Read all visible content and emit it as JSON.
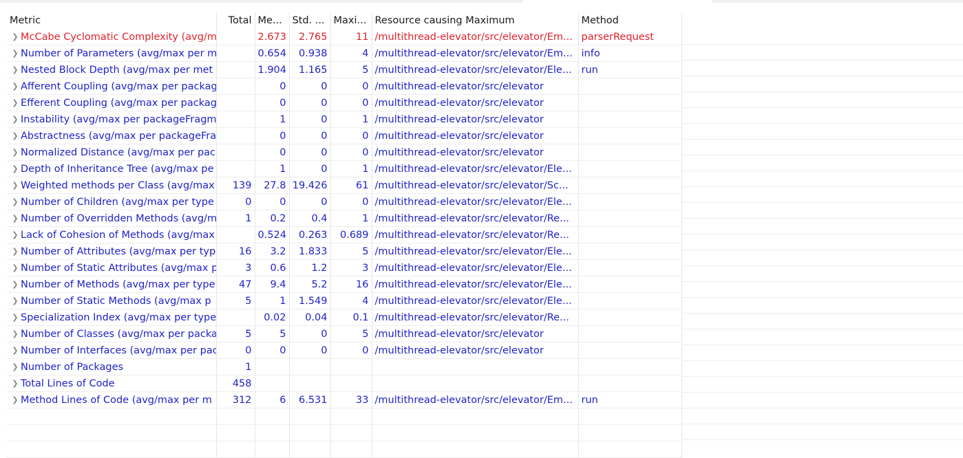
{
  "columns": {
    "metric": "Metric",
    "total": "Total",
    "mean": "Me...",
    "std": "Std. ...",
    "max": "Maxi...",
    "resource": "Resource causing Maximum",
    "method": "Method"
  },
  "rows": [
    {
      "metric": "McCabe Cyclomatic Complexity (avg/m",
      "total": "",
      "mean": "2.673",
      "std": "2.765",
      "max": "11",
      "resource": "/multithread-elevator/src/elevator/Em...",
      "method": "parserRequest"
    },
    {
      "metric": "Number of Parameters (avg/max per m",
      "total": "",
      "mean": "0.654",
      "std": "0.938",
      "max": "4",
      "resource": "/multithread-elevator/src/elevator/Em...",
      "method": "info"
    },
    {
      "metric": "Nested Block Depth (avg/max per met",
      "total": "",
      "mean": "1.904",
      "std": "1.165",
      "max": "5",
      "resource": "/multithread-elevator/src/elevator/Ele...",
      "method": "run"
    },
    {
      "metric": "Afferent Coupling (avg/max per packag",
      "total": "",
      "mean": "0",
      "std": "0",
      "max": "0",
      "resource": "/multithread-elevator/src/elevator",
      "method": ""
    },
    {
      "metric": "Efferent Coupling (avg/max per packag",
      "total": "",
      "mean": "0",
      "std": "0",
      "max": "0",
      "resource": "/multithread-elevator/src/elevator",
      "method": ""
    },
    {
      "metric": "Instability (avg/max per packageFragm",
      "total": "",
      "mean": "1",
      "std": "0",
      "max": "1",
      "resource": "/multithread-elevator/src/elevator",
      "method": ""
    },
    {
      "metric": "Abstractness (avg/max per packageFra",
      "total": "",
      "mean": "0",
      "std": "0",
      "max": "0",
      "resource": "/multithread-elevator/src/elevator",
      "method": ""
    },
    {
      "metric": "Normalized Distance (avg/max per pac",
      "total": "",
      "mean": "0",
      "std": "0",
      "max": "0",
      "resource": "/multithread-elevator/src/elevator",
      "method": ""
    },
    {
      "metric": "Depth of Inheritance Tree (avg/max pe",
      "total": "",
      "mean": "1",
      "std": "0",
      "max": "1",
      "resource": "/multithread-elevator/src/elevator/Ele...",
      "method": ""
    },
    {
      "metric": "Weighted methods per Class (avg/max",
      "total": "139",
      "mean": "27.8",
      "std": "19.426",
      "max": "61",
      "resource": "/multithread-elevator/src/elevator/Sc...",
      "method": ""
    },
    {
      "metric": "Number of Children (avg/max per type",
      "total": "0",
      "mean": "0",
      "std": "0",
      "max": "0",
      "resource": "/multithread-elevator/src/elevator/Ele...",
      "method": ""
    },
    {
      "metric": "Number of Overridden Methods (avg/m",
      "total": "1",
      "mean": "0.2",
      "std": "0.4",
      "max": "1",
      "resource": "/multithread-elevator/src/elevator/Re...",
      "method": ""
    },
    {
      "metric": "Lack of Cohesion of Methods (avg/max",
      "total": "",
      "mean": "0.524",
      "std": "0.263",
      "max": "0.689",
      "resource": "/multithread-elevator/src/elevator/Re...",
      "method": ""
    },
    {
      "metric": "Number of Attributes (avg/max per typ",
      "total": "16",
      "mean": "3.2",
      "std": "1.833",
      "max": "5",
      "resource": "/multithread-elevator/src/elevator/Ele...",
      "method": ""
    },
    {
      "metric": "Number of Static Attributes (avg/max p",
      "total": "3",
      "mean": "0.6",
      "std": "1.2",
      "max": "3",
      "resource": "/multithread-elevator/src/elevator/Ele...",
      "method": ""
    },
    {
      "metric": "Number of Methods (avg/max per type",
      "total": "47",
      "mean": "9.4",
      "std": "5.2",
      "max": "16",
      "resource": "/multithread-elevator/src/elevator/Ele...",
      "method": ""
    },
    {
      "metric": "Number of Static Methods (avg/max p",
      "total": "5",
      "mean": "1",
      "std": "1.549",
      "max": "4",
      "resource": "/multithread-elevator/src/elevator/Ele...",
      "method": ""
    },
    {
      "metric": "Specialization Index (avg/max per type",
      "total": "",
      "mean": "0.02",
      "std": "0.04",
      "max": "0.1",
      "resource": "/multithread-elevator/src/elevator/Re...",
      "method": ""
    },
    {
      "metric": "Number of Classes (avg/max per packa",
      "total": "5",
      "mean": "5",
      "std": "0",
      "max": "5",
      "resource": "/multithread-elevator/src/elevator",
      "method": ""
    },
    {
      "metric": "Number of Interfaces (avg/max per pac",
      "total": "0",
      "mean": "0",
      "std": "0",
      "max": "0",
      "resource": "/multithread-elevator/src/elevator",
      "method": ""
    },
    {
      "metric": "Number of Packages",
      "total": "1",
      "mean": "",
      "std": "",
      "max": "",
      "resource": "",
      "method": ""
    },
    {
      "metric": "Total Lines of Code",
      "total": "458",
      "mean": "",
      "std": "",
      "max": "",
      "resource": "",
      "method": ""
    },
    {
      "metric": "Method Lines of Code (avg/max per m",
      "total": "312",
      "mean": "6",
      "std": "6.531",
      "max": "33",
      "resource": "/multithread-elevator/src/elevator/Em...",
      "method": "run"
    }
  ],
  "highlight_row_index": 0,
  "colors": {
    "normal_text": "#1f22c8",
    "warning_text": "#e0202a"
  },
  "icons": {
    "row_expander": "chevron-right-icon"
  }
}
